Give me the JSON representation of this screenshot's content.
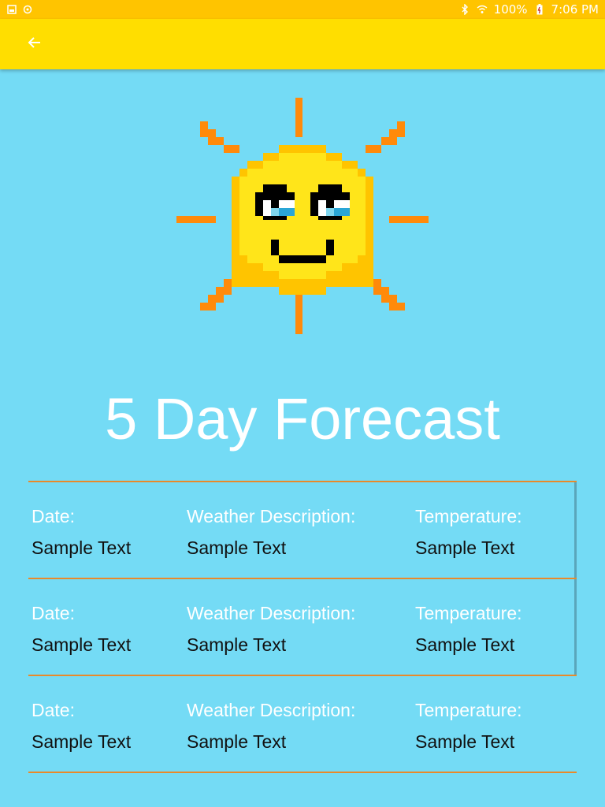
{
  "status_bar": {
    "battery": "100%",
    "time": "7:06 PM"
  },
  "title": "5 Day Forecast",
  "forecast": [
    {
      "date_label": "Date:",
      "date_value": "Sample Text",
      "desc_label": "Weather Description:",
      "desc_value": "Sample Text",
      "temp_label": "Temperature:",
      "temp_value": "Sample Text"
    },
    {
      "date_label": "Date:",
      "date_value": "Sample Text",
      "desc_label": "Weather Description:",
      "desc_value": "Sample Text",
      "temp_label": "Temperature:",
      "temp_value": "Sample Text"
    },
    {
      "date_label": "Date:",
      "date_value": "Sample Text",
      "desc_label": "Weather Description:",
      "desc_value": "Sample Text",
      "temp_label": "Temperature:",
      "temp_value": "Sample Text"
    }
  ],
  "icons": {
    "back": "arrow-left-icon",
    "sun": "smiling-sun-icon"
  },
  "colors": {
    "status_bar": "#ffc400",
    "app_bar": "#ffde00",
    "background": "#74dbf5",
    "divider": "#e98a2a"
  }
}
